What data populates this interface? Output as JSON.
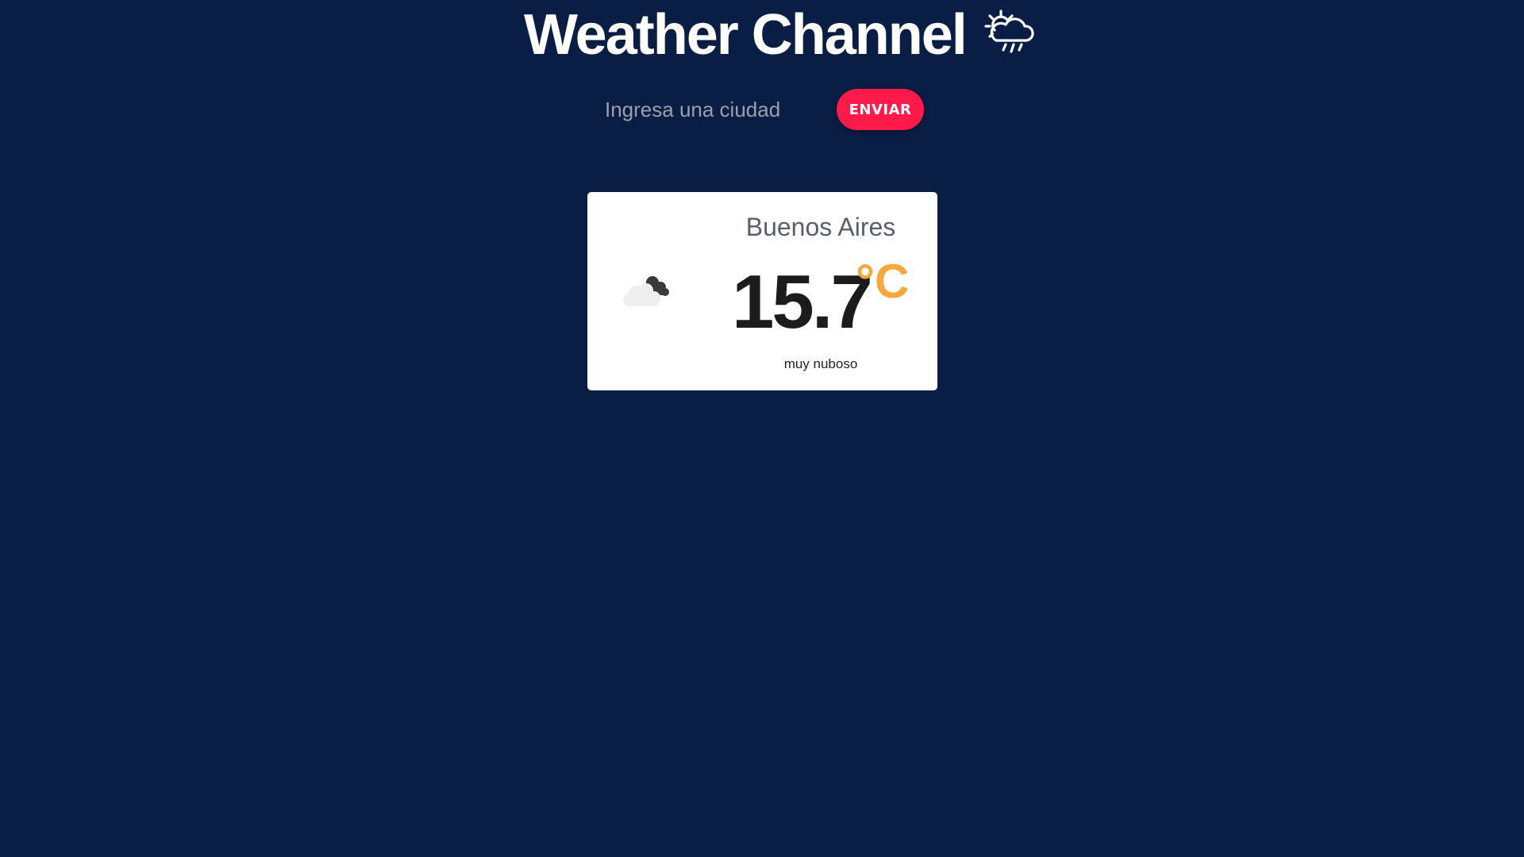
{
  "header": {
    "title": "Weather Channel",
    "icon": "cloud-sun-rain-icon"
  },
  "search": {
    "placeholder": "Ingresa una ciudad",
    "value": "",
    "button_label": "ENVIAR"
  },
  "weather": {
    "city": "Buenos Aires",
    "temperature": "15.7",
    "unit": "°C",
    "description": "muy nuboso",
    "icon": "overcast-clouds-icon"
  },
  "colors": {
    "background": "#0a1e45",
    "accent_button": "#ff1a4a",
    "unit": "#f6a83c",
    "card": "#ffffff"
  }
}
